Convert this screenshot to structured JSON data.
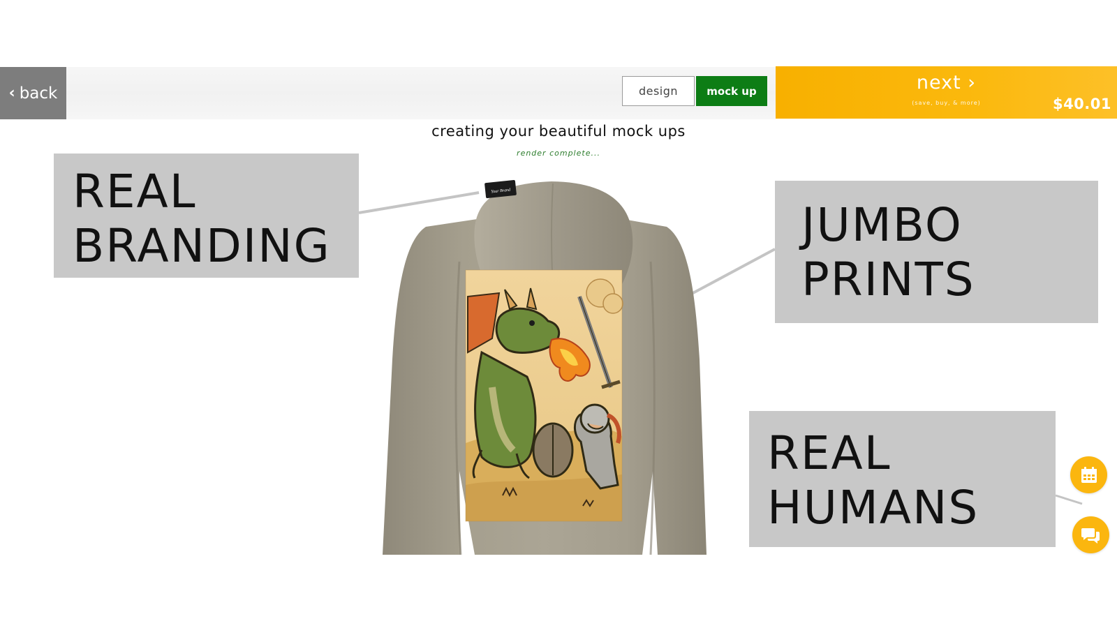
{
  "topbar": {
    "back_label": "back",
    "tabs": [
      {
        "label": "design",
        "active": false
      },
      {
        "label": "mock up",
        "active": true
      }
    ],
    "next_label": "next",
    "next_sub": "(save, buy, & more)",
    "price": "$40.01",
    "accent_color": "#fbb60f",
    "active_tab_color": "#0d7d15"
  },
  "main": {
    "headline": "creating your beautiful mock ups",
    "status": "render complete..."
  },
  "callouts": {
    "branding": [
      "REAL",
      "BRANDING"
    ],
    "jumbo": [
      "JUMBO",
      "PRINTS"
    ],
    "humans": [
      "REAL",
      "HUMANS"
    ]
  },
  "mockup": {
    "product": "hoodie",
    "color": "#a39c8b",
    "neck_label": "Your Brand"
  },
  "fabs": {
    "calendar_icon": "calendar-icon",
    "chat_icon": "chat-icon"
  }
}
